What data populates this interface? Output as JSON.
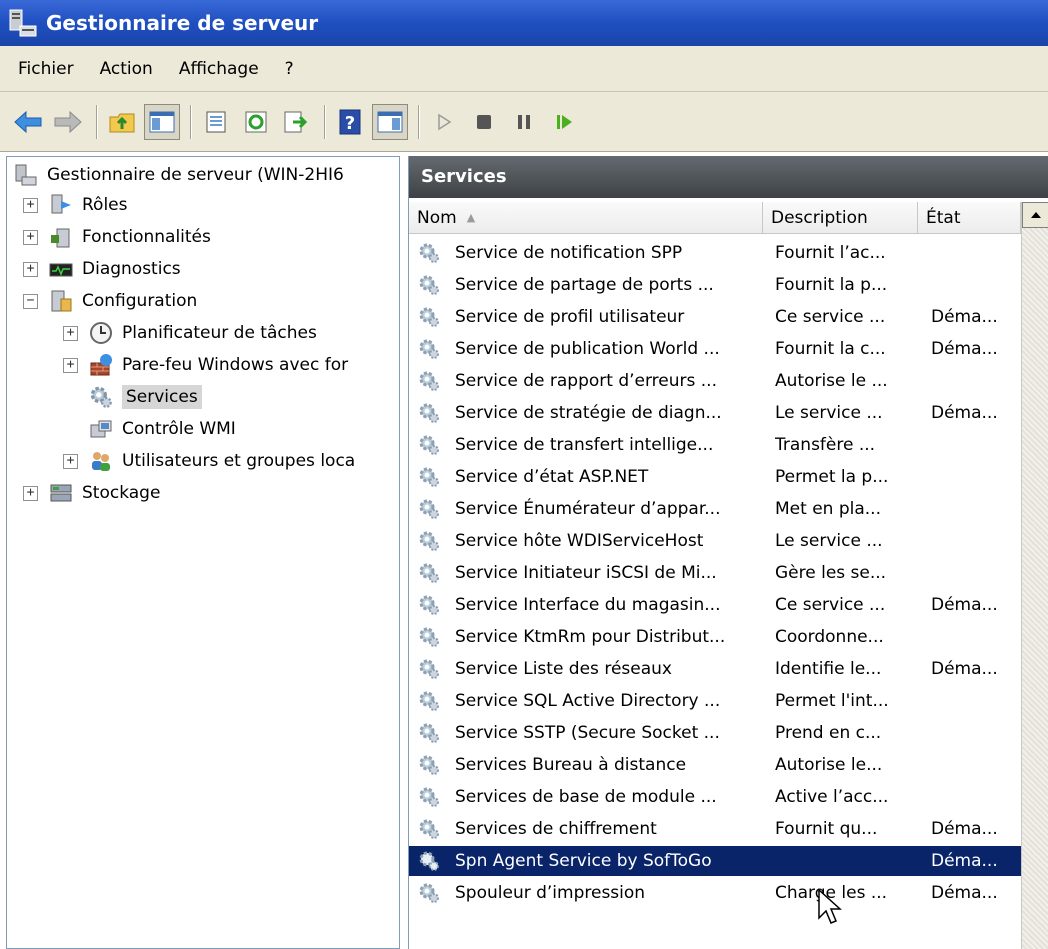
{
  "window": {
    "title": "Gestionnaire de serveur"
  },
  "menu": [
    "Fichier",
    "Action",
    "Affichage",
    "?"
  ],
  "toolbar": {
    "icons": [
      "back-arrow-icon",
      "forward-arrow-icon",
      "up-folder-icon",
      "show-hide-console-tree-icon",
      "properties-icon",
      "refresh-icon",
      "export-list-icon",
      "help-icon",
      "show-hide-action-pane-icon",
      "play-icon",
      "stop-icon",
      "pause-icon",
      "restart-icon"
    ]
  },
  "tree": {
    "root": "Gestionnaire de serveur (WIN-2HI6",
    "items": [
      {
        "label": "Rôles",
        "expander": "+",
        "icon": "roles-icon"
      },
      {
        "label": "Fonctionnalités",
        "expander": "+",
        "icon": "features-icon"
      },
      {
        "label": "Diagnostics",
        "expander": "+",
        "icon": "diagnostics-icon"
      },
      {
        "label": "Configuration",
        "expander": "−",
        "icon": "configuration-icon"
      },
      {
        "label": "Planificateur de tâches",
        "expander": "+",
        "icon": "clock-icon"
      },
      {
        "label": "Pare-feu Windows avec for",
        "expander": "+",
        "icon": "firewall-icon"
      },
      {
        "label": "Services",
        "expander": "",
        "icon": "gear-icon",
        "selected": true
      },
      {
        "label": "Contrôle WMI",
        "expander": "",
        "icon": "wmi-icon"
      },
      {
        "label": "Utilisateurs et groupes loca",
        "expander": "+",
        "icon": "users-icon"
      },
      {
        "label": "Stockage",
        "expander": "+",
        "icon": "storage-icon"
      }
    ]
  },
  "services_pane": {
    "header": "Services",
    "columns": {
      "name": "Nom",
      "description": "Description",
      "state": "État"
    },
    "rows": [
      {
        "name": "Service de notification SPP",
        "description": "Fournit l’ac...",
        "state": ""
      },
      {
        "name": "Service de partage de ports ...",
        "description": "Fournit la p...",
        "state": ""
      },
      {
        "name": "Service de profil utilisateur",
        "description": "Ce service ...",
        "state": "Déma..."
      },
      {
        "name": "Service de publication World ...",
        "description": "Fournit la c...",
        "state": "Déma..."
      },
      {
        "name": "Service de rapport d’erreurs ...",
        "description": "Autorise le ...",
        "state": ""
      },
      {
        "name": "Service de stratégie de diagn...",
        "description": "Le service ...",
        "state": "Déma..."
      },
      {
        "name": "Service de transfert intellige...",
        "description": "Transfère ...",
        "state": ""
      },
      {
        "name": "Service d’état ASP.NET",
        "description": "Permet la p...",
        "state": ""
      },
      {
        "name": "Service Énumérateur d’appar...",
        "description": "Met en pla...",
        "state": ""
      },
      {
        "name": "Service hôte WDIServiceHost",
        "description": "Le service ...",
        "state": ""
      },
      {
        "name": "Service Initiateur iSCSI de Mi...",
        "description": "Gère les se...",
        "state": ""
      },
      {
        "name": "Service Interface du magasin...",
        "description": "Ce service ...",
        "state": "Déma..."
      },
      {
        "name": "Service KtmRm pour Distribut...",
        "description": "Coordonne...",
        "state": ""
      },
      {
        "name": "Service Liste des réseaux",
        "description": "Identifie le...",
        "state": "Déma..."
      },
      {
        "name": "Service SQL Active Directory ...",
        "description": "Permet l'int...",
        "state": ""
      },
      {
        "name": "Service SSTP (Secure Socket ...",
        "description": "Prend en c...",
        "state": ""
      },
      {
        "name": "Services Bureau à distance",
        "description": "Autorise le...",
        "state": ""
      },
      {
        "name": "Services de base de module ...",
        "description": "Active l’acc...",
        "state": ""
      },
      {
        "name": "Services de chiffrement",
        "description": "Fournit qu...",
        "state": "Déma..."
      },
      {
        "name": "Spn Agent Service by SofToGo",
        "description": "",
        "state": "Déma...",
        "selected": true
      },
      {
        "name": "Spouleur d’impression",
        "description": "Charge les ...",
        "state": "Déma..."
      }
    ]
  },
  "colors": {
    "title_bar": "#1f4fc0",
    "selection": "#0a246a",
    "pane_header": "#4f5459"
  }
}
